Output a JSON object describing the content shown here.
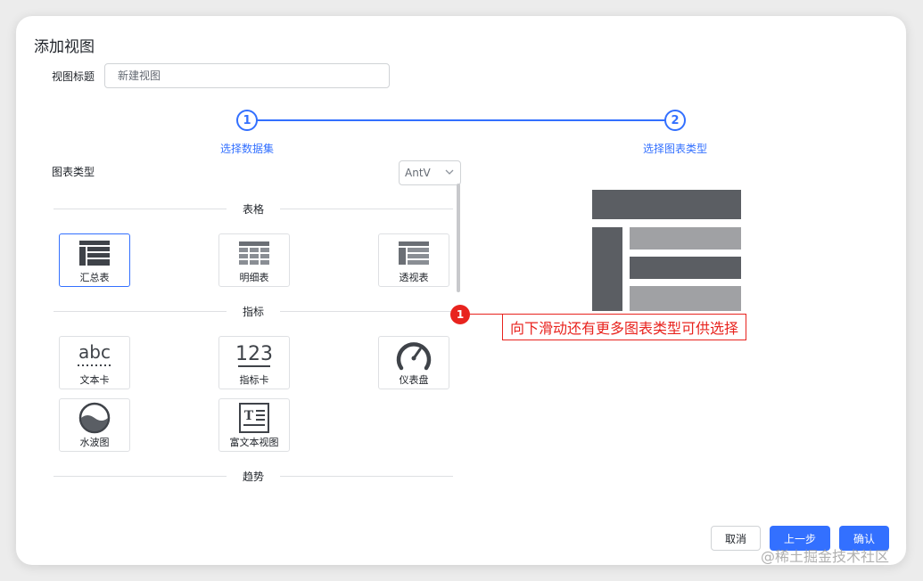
{
  "dialog": {
    "title": "添加视图"
  },
  "view_title": {
    "label": "视图标题",
    "value": "新建视图"
  },
  "steps": [
    {
      "number": "1",
      "label": "选择数据集"
    },
    {
      "number": "2",
      "label": "选择图表类型"
    }
  ],
  "chart_type": {
    "label": "图表类型",
    "library": "AntV",
    "sections": [
      {
        "title": "表格",
        "items": [
          {
            "label": "汇总表",
            "icon": "summary-table-icon",
            "selected": true
          },
          {
            "label": "明细表",
            "icon": "detail-table-icon",
            "selected": false
          },
          {
            "label": "透视表",
            "icon": "pivot-table-icon",
            "selected": false
          }
        ]
      },
      {
        "title": "指标",
        "items": [
          {
            "label": "文本卡",
            "icon": "text-card-icon",
            "selected": false
          },
          {
            "label": "指标卡",
            "icon": "indicator-card-icon",
            "selected": false
          },
          {
            "label": "仪表盘",
            "icon": "gauge-icon",
            "selected": false
          },
          {
            "label": "水波图",
            "icon": "liquid-icon",
            "selected": false
          },
          {
            "label": "富文本视图",
            "icon": "rich-text-icon",
            "selected": false
          }
        ]
      },
      {
        "title": "趋势",
        "items": []
      }
    ]
  },
  "annotation": {
    "number": "1",
    "text": "向下滑动还有更多图表类型可供选择"
  },
  "footer": {
    "cancel": "取消",
    "prev": "上一步",
    "confirm": "确认"
  },
  "watermark": "@稀土掘金技术社区",
  "colors": {
    "accent": "#3370ff",
    "annotation": "#e8231e"
  }
}
